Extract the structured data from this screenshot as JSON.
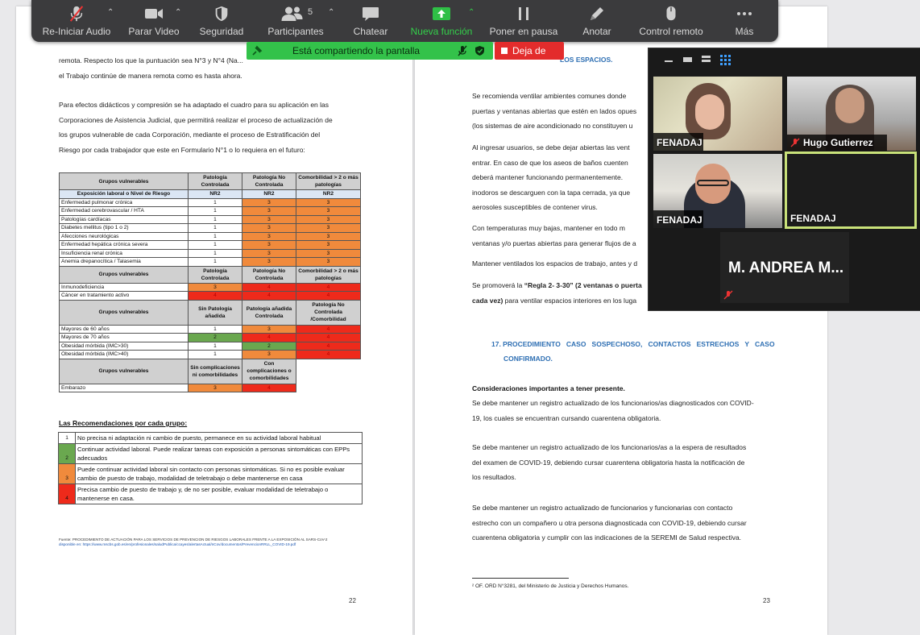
{
  "toolbar": {
    "audio": "Re-Iniciar Audio",
    "video": "Parar Video",
    "security": "Seguridad",
    "participants": "Participantes",
    "participants_count": "5",
    "chat": "Chatear",
    "share": "Nueva función",
    "pause": "Poner en pausa",
    "annotate": "Anotar",
    "remote": "Control remoto",
    "more": "Más"
  },
  "share_banner": {
    "text": "Está compartiendo la pantalla",
    "stop": "Deja de"
  },
  "video_panel": {
    "tiles": [
      {
        "name": "FENADAJ"
      },
      {
        "name": "Hugo Gutierrez"
      },
      {
        "name": "FENADAJ"
      },
      {
        "name": "FENADAJ"
      },
      {
        "name": "M. ANDREA M..."
      }
    ]
  },
  "doc_left": {
    "intro": [
      "remota. Respecto los que la puntuación sea N°3 y N°4 (Na...",
      "el Trabajo continúe de manera remota como es hasta ahora."
    ],
    "para2": [
      "Para efectos didácticos y compresión se ha adaptado el cuadro para su aplicación en las",
      "Corporaciones de Asistencia Judicial, que permitirá realizar el proceso de actualización de",
      "los grupos vulnerable de cada Corporación, mediante el proceso de Estratificación del",
      "Riesgo por cada trabajador que este en Formulario N°1 o lo requiera en el futuro:"
    ],
    "table": {
      "header1": [
        "Grupos vulnerables",
        "Patología Controlada",
        "Patología No Controlada",
        "Comorbilidad > 2 o más patologías"
      ],
      "exposure": [
        "Exposición laboral o Nivel de Riesgo",
        "NR2",
        "NR2",
        "NR2"
      ],
      "rows1": [
        [
          "Enfermedad pulmonar crónica",
          "1",
          "3",
          "3"
        ],
        [
          "Enfermedad cerebrovascular / HTA",
          "1",
          "3",
          "3"
        ],
        [
          "Patologías cardíacas",
          "1",
          "3",
          "3"
        ],
        [
          "Diabetes mellitus (tipo 1 o 2)",
          "1",
          "3",
          "3"
        ],
        [
          "Afecciones neurológicas",
          "1",
          "3",
          "3"
        ],
        [
          "Enfermedad hepática crónica severa",
          "1",
          "3",
          "3"
        ],
        [
          "Insuficiencia renal crónica",
          "1",
          "3",
          "3"
        ],
        [
          "Anemia drepanocítica / Talasemia",
          "1",
          "3",
          "3"
        ]
      ],
      "header2": [
        "Grupos vulnerables",
        "Patología Controlada",
        "Patología No Controlada",
        "Comorbilidad > 2 o más patologías"
      ],
      "rows2": [
        [
          "Inmunodeficiencia",
          "3",
          "4",
          "4"
        ],
        [
          "Cáncer en tratamiento activo",
          "4",
          "4",
          "4"
        ]
      ],
      "header3": [
        "Grupos vulnerables",
        "Sin Patología añadida",
        "Patología añadida Controlada",
        "Patología No Controlada /Comorbilidad"
      ],
      "rows3": [
        [
          "Mayores de 60 años",
          "1",
          "3",
          "4"
        ],
        [
          "Mayores de 70 años",
          "2",
          "4",
          "4"
        ],
        [
          "Obesidad mórbida (IMC>30)",
          "1",
          "2",
          "4"
        ],
        [
          "Obesidad mórbida (IMC>40)",
          "1",
          "3",
          "4"
        ]
      ],
      "header4": [
        "Grupos vulnerables",
        "Sin complicaciones ni comorbilidades",
        "Con complicaciones o comorbilidades"
      ],
      "rows4": [
        [
          "Embarazo",
          "3",
          "4"
        ]
      ]
    },
    "rec_title": "Las Recomendaciones por cada grupo:",
    "recommendations": [
      {
        "level": "1",
        "text": "No precisa ni adaptación ni cambio de puesto, permanece en su actividad laboral habitual"
      },
      {
        "level": "2",
        "text": "Continuar actividad laboral. Puede realizar tareas con exposición a personas sintomáticas con EPPs adecuados"
      },
      {
        "level": "3",
        "text": "Puede continuar actividad laboral sin contacto con personas sintomáticas. Si no es posible evaluar cambio de puesto de trabajo, modalidad de teletrabajo o debe mantenerse en casa"
      },
      {
        "level": "4",
        "text": "Precisa cambio de puesto de trabajo y, de no ser posible, evaluar modalidad de teletrabajo o mantenerse en casa."
      }
    ],
    "source_line1": "Fuente: PROCEDIMIENTO DE ACTUACIÓN PARA LOS SERVICIOS DE PREVENCION DE RIESGOS LABORALES FRENTE A LA EXPOSICIÓN AL SARS-CoV-2",
    "source_line2": "disponible en: https://www.mscbs.gob.es/en/profesionales/saludPublica/ccayes/alertasActual/nCov/documentos/PrevencionRRLL_COVID-19.pdf",
    "page_number": "22"
  },
  "doc_right": {
    "top_heading": "LOS ESPACIOS.",
    "para1": [
      "Se recomienda ventilar ambientes comunes donde",
      "puertas y ventanas abiertas que estén en lados opues",
      "(los sistemas de aire acondicionado no constituyen u"
    ],
    "para2": [
      "Al ingresar usuarios, se debe dejar abiertas las vent",
      "entrar. En caso de que los aseos de baños cuenten",
      "deberá mantener funcionando permanentemente.",
      "inodoros se descarguen con la tapa cerrada, ya que",
      "aerosoles susceptibles de contener virus."
    ],
    "para3": [
      "Con temperaturas muy bajas, mantener en todo m",
      "ventanas y/o puertas abiertas para generar flujos de a"
    ],
    "para4": "Mantener ventilados los espacios de trabajo, antes y d",
    "para5_bold": "“Regla 2- 3-30” (2 ventanas o puerta",
    "para5_prefix": "Se promoverá la ",
    "para5_bold2": "cada vez)",
    "para5_suffix": " para ventilar espacios interiores en los luga",
    "section_heading1": "17. PROCEDIMIENTO   CASO   SOSPECHOSO,   CONTACTOS   ESTRECHOS   Y   CASO",
    "section_heading2": "CONFIRMADO.",
    "considerations_title": "Consideraciones importantes a tener presente.",
    "c1": [
      "Se debe mantener un registro actualizado de los funcionarios/as diagnosticados con COVID-",
      "19, los cuales se encuentran cursando cuarentena obligatoria."
    ],
    "c2": [
      "Se debe mantener un registro actualizado de los funcionarios/as a la espera de resultados",
      "del examen de COVID-19, debiendo cursar cuarentena obligatoria hasta la notificación de",
      "los resultados."
    ],
    "c3": [
      "Se debe mantener un registro actualizado de funcionarios y funcionarias con contacto",
      "estrecho con un compañero u otra persona diagnosticada con COVID-19, debiendo cursar",
      "cuarentena obligatoria y cumplir con las indicaciones de la SEREMI de Salud respectiva."
    ],
    "footnote": "² OF. ORD N°3281, del Ministerio de Justicia y Derechos Humanos.",
    "page_number": "23"
  }
}
